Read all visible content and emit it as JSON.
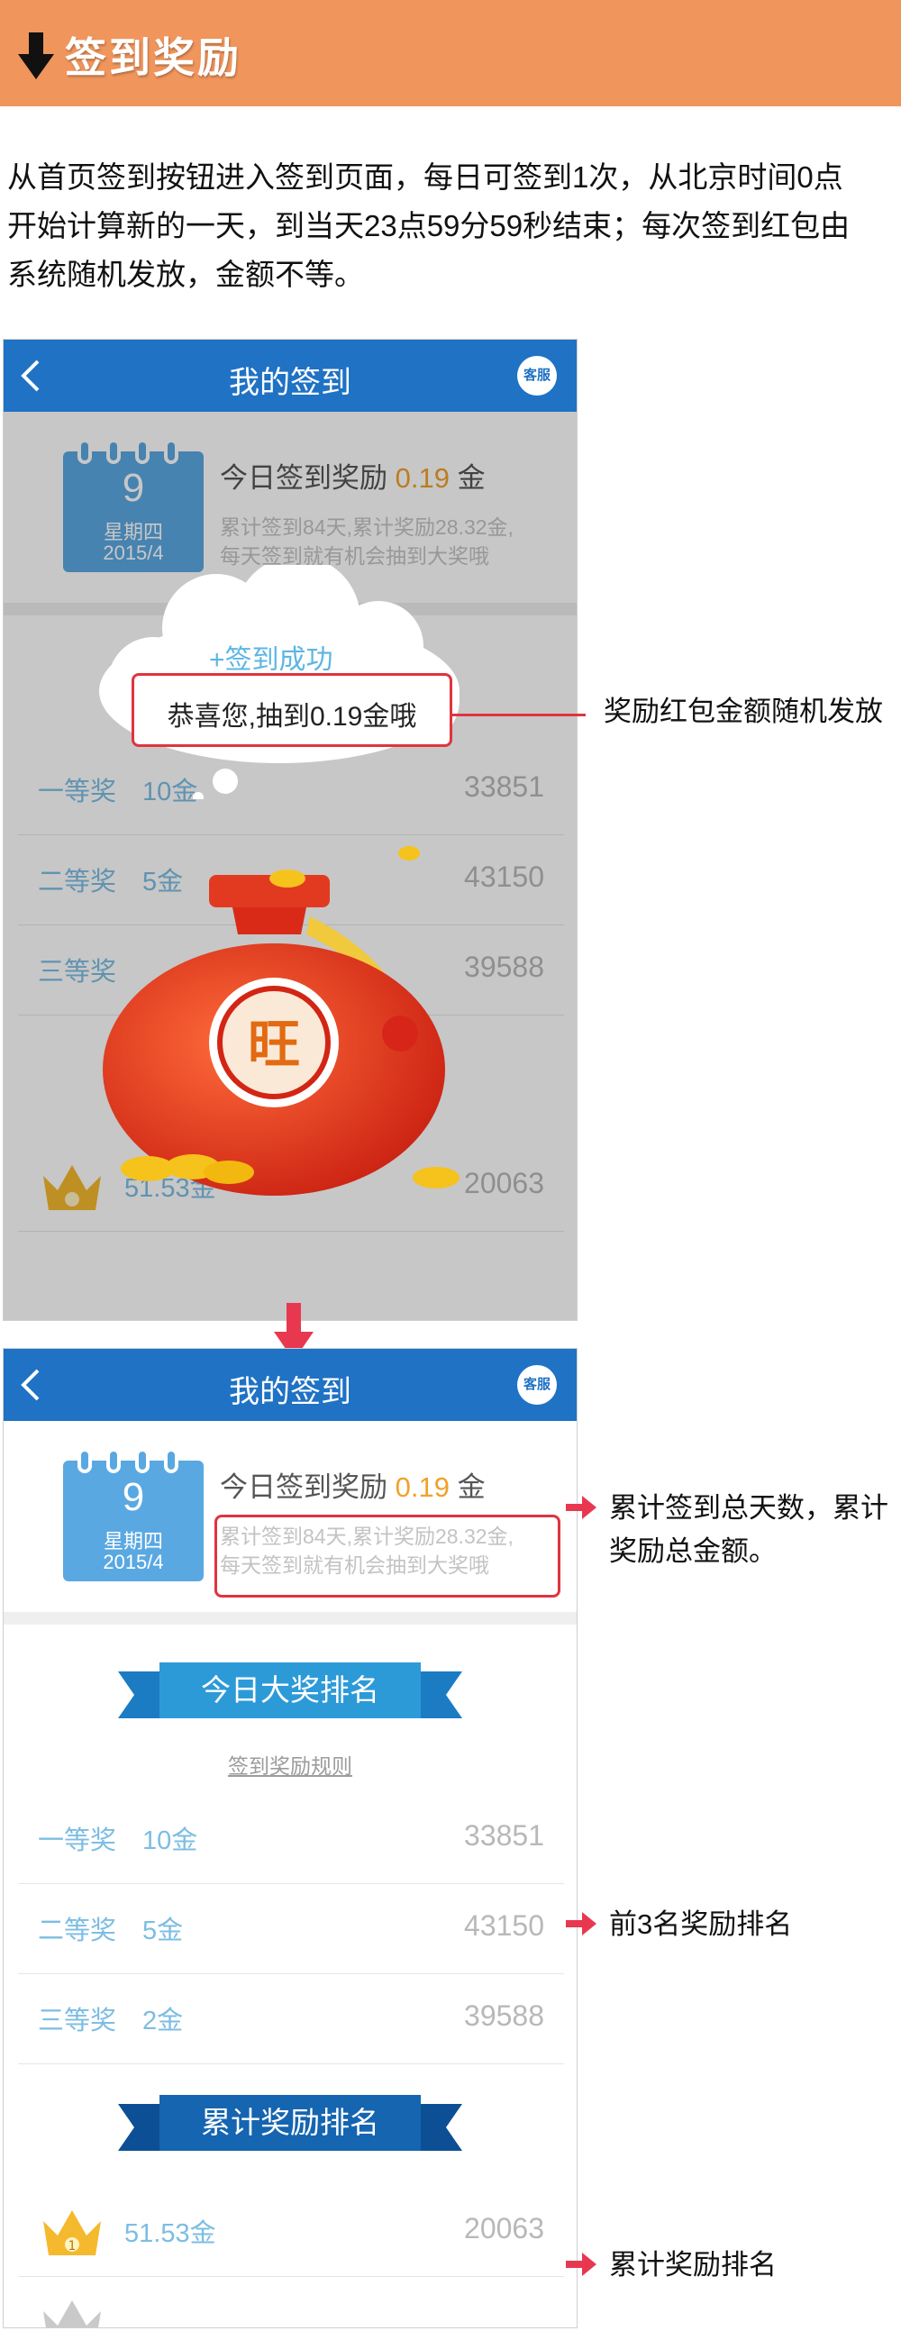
{
  "header": {
    "title": "签到奖励",
    "icon": "down-arrow-icon"
  },
  "intro": {
    "line1": "从首页签到按钮进入签到页面，每日可签到1次，从北京时间0点",
    "line2": "开始计算新的一天，到当天23点59分59秒结束；每次签到红包由",
    "line3": "系统随机发放，金额不等。"
  },
  "phone": {
    "nav_title": "我的签到",
    "service_label": "客服",
    "calendar": {
      "day": "9",
      "weekday": "星期四",
      "date": "2015/4"
    },
    "reward_prefix": "今日签到奖励 ",
    "reward_amount": "0.19",
    "reward_unit": " 金",
    "summary_line1": "累计签到84天,累计奖励28.32金,",
    "summary_line2": "每天签到就有机会抽到大奖哦",
    "today_ranking_title": "今日大奖排名",
    "rules_link": "签到奖励规则",
    "prizes": [
      {
        "level": "一等奖",
        "prize": "10金",
        "count": "33851"
      },
      {
        "level": "二等奖",
        "prize": "5金",
        "count": "43150"
      },
      {
        "level": "三等奖",
        "prize": "2金",
        "count": "39588"
      }
    ],
    "accum_ranking_title": "累计奖励排名",
    "accum_first": {
      "rank": "1",
      "amount": "51.53金",
      "count": "20063"
    },
    "popup": {
      "success": "+签到成功",
      "message": "恭喜您,抽到0.19金哦",
      "bag_char": "旺"
    }
  },
  "phone1_prizes": [
    {
      "level": "一等奖",
      "prize": "10金",
      "count": "33851"
    },
    {
      "level": "二等奖",
      "prize": "5金",
      "count": "43150"
    },
    {
      "level": "三等奖",
      "prize": "",
      "count": "39588"
    }
  ],
  "annotations": {
    "random_reward": "奖励红包金额随机发放",
    "summary_note_1": "累计签到总天数，累计",
    "summary_note_2": "奖励总金额。",
    "top3_note": "前3名奖励排名",
    "accum_note": "累计奖励排名"
  },
  "colors": {
    "banner": "#f0955b",
    "nav": "#1f72c4",
    "accent_amount": "#f1a12a",
    "highlight_red": "#e0343f",
    "ribbon_light": "#2d9ad8",
    "ribbon_dark": "#1565b0"
  }
}
